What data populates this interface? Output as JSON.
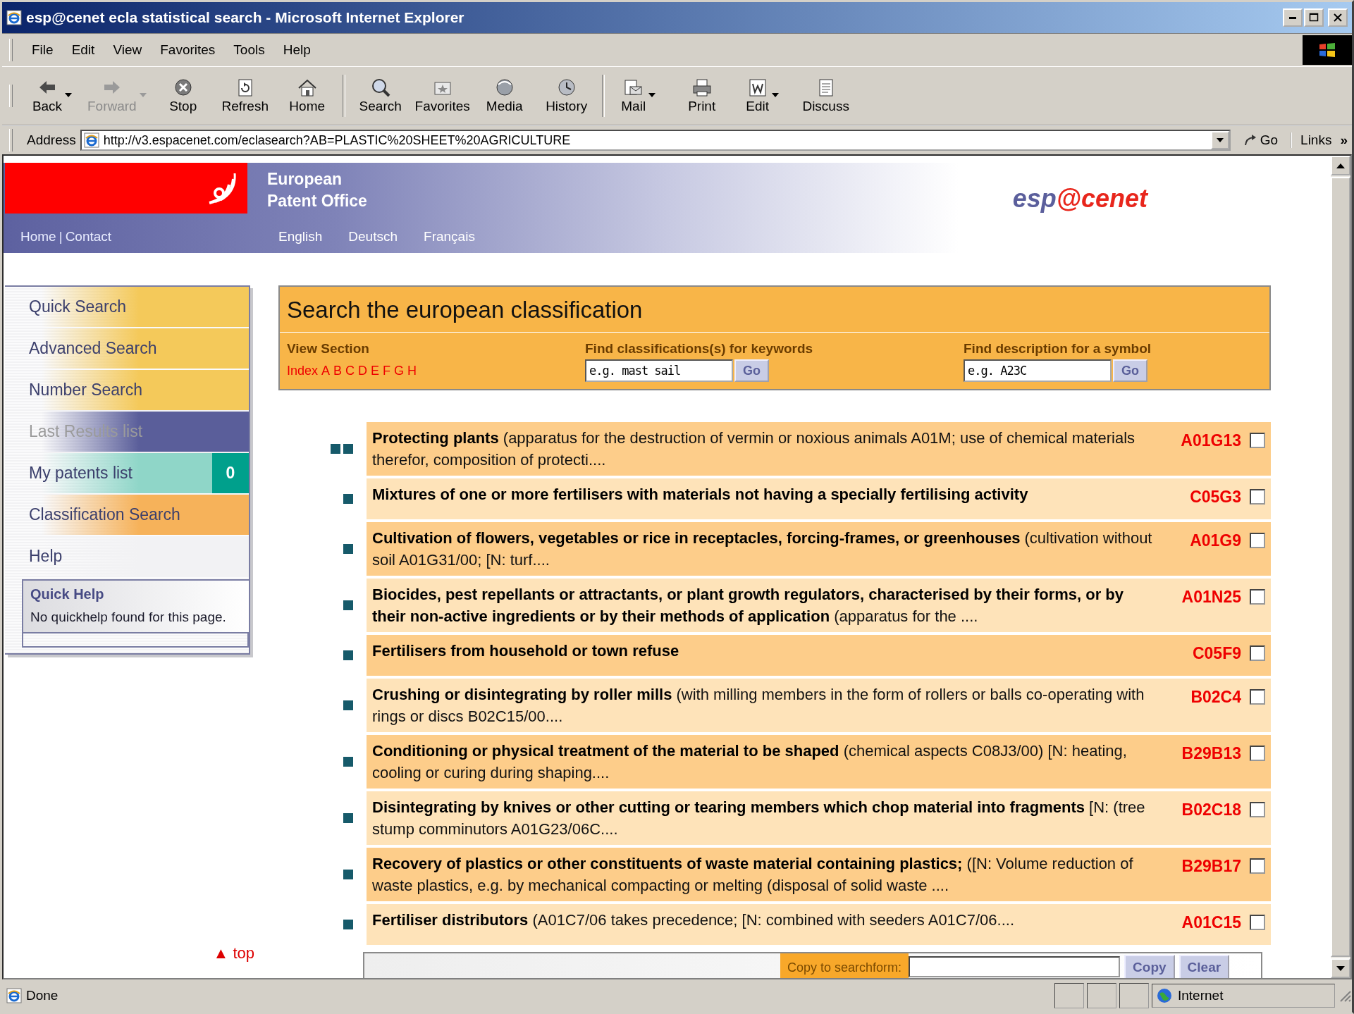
{
  "window": {
    "title": "esp@cenet ecla statistical search - Microsoft Internet Explorer"
  },
  "menu": [
    "File",
    "Edit",
    "View",
    "Favorites",
    "Tools",
    "Help"
  ],
  "toolbar": [
    [
      {
        "label": "Back",
        "kind": "back",
        "disabled": false,
        "dropdown": true
      },
      {
        "label": "Forward",
        "kind": "forward",
        "disabled": true,
        "dropdown": true
      },
      {
        "label": "Stop",
        "kind": "stop",
        "disabled": false,
        "dropdown": false
      },
      {
        "label": "Refresh",
        "kind": "refresh",
        "disabled": false,
        "dropdown": false
      },
      {
        "label": "Home",
        "kind": "home",
        "disabled": false,
        "dropdown": false
      }
    ],
    [
      {
        "label": "Search",
        "kind": "search",
        "disabled": false,
        "dropdown": false
      },
      {
        "label": "Favorites",
        "kind": "favorites",
        "disabled": false,
        "dropdown": false
      },
      {
        "label": "Media",
        "kind": "media",
        "disabled": false,
        "dropdown": false
      },
      {
        "label": "History",
        "kind": "history",
        "disabled": false,
        "dropdown": false
      }
    ],
    [
      {
        "label": "Mail",
        "kind": "mail",
        "disabled": false,
        "dropdown": true
      },
      {
        "label": "Print",
        "kind": "print",
        "disabled": false,
        "dropdown": false
      },
      {
        "label": "Edit",
        "kind": "edit",
        "disabled": false,
        "dropdown": true
      },
      {
        "label": "Discuss",
        "kind": "discuss",
        "disabled": false,
        "dropdown": false
      }
    ]
  ],
  "address": {
    "label": "Address",
    "url": "http://v3.espacenet.com/eclasearch?AB=PLASTIC%20SHEET%20AGRICULTURE",
    "go": "Go",
    "links": "Links",
    "more": "»"
  },
  "site_header": {
    "org": [
      "European",
      "Patent Office"
    ],
    "home_links": [
      "Home",
      "|",
      "Contact"
    ],
    "languages": [
      "English",
      "Deutsch",
      "Français"
    ],
    "logo": [
      {
        "text": "esp",
        "color": "#5b5f9c"
      },
      {
        "text": "@",
        "color": "#e8261c"
      },
      {
        "text": "cenet",
        "color": "#e8261c"
      }
    ]
  },
  "sidebar": {
    "items": [
      {
        "label": "Quick Search",
        "color": "#f4c95a",
        "disabled": false
      },
      {
        "label": "Advanced Search",
        "color": "#f4c95a",
        "disabled": false
      },
      {
        "label": "Number Search",
        "color": "#f4c95a",
        "disabled": false
      },
      {
        "label": "Last Results list",
        "color": "#5a5e9a",
        "disabled": true
      },
      {
        "label": "My patents list",
        "color": "#8fd6c8",
        "disabled": false,
        "badge": "0"
      },
      {
        "label": "Classification Search",
        "color": "#f6b25a",
        "disabled": false
      },
      {
        "label": "Help",
        "color": "#f2f2f4",
        "disabled": false
      }
    ],
    "quick_help": {
      "title": "Quick Help",
      "text": "No quickhelp found for this page."
    },
    "top_link": {
      "arrow": "▲",
      "label": "top"
    }
  },
  "search_panel": {
    "title": "Search the european classification",
    "view_section": {
      "label": "View Section",
      "index": "Index",
      "letters": [
        "A",
        "B",
        "C",
        "D",
        "E",
        "F",
        "G",
        "H"
      ]
    },
    "keywords": {
      "label": "Find classifications(s) for keywords",
      "value": "e.g. mast sail",
      "button": "Go"
    },
    "symbol": {
      "label": "Find description for a symbol",
      "value": "e.g. A23C",
      "button": "Go"
    }
  },
  "results": [
    {
      "kind": "double",
      "text": "**Protecting plants** (apparatus for the destruction of vermin or noxious animals A01M; use of chemical materials therefor, composition of protecti....",
      "code": "A01G13",
      "checked": false
    },
    {
      "kind": "single",
      "text": "**Mixtures of one or more fertilisers with materials not having a specially fertilising activity**",
      "code": "C05G3",
      "checked": false
    },
    {
      "kind": "single",
      "text": "**Cultivation of flowers, vegetables or rice in receptacles, forcing-frames, or greenhouses** (cultivation without soil A01G31/00; [N: turf....",
      "code": "A01G9",
      "checked": false
    },
    {
      "kind": "single",
      "text": "**Biocides, pest repellants or attractants, or plant growth regulators, characterised by their forms, or by their non-active ingredients or by their methods of application** (apparatus for the ....",
      "code": "A01N25",
      "checked": false
    },
    {
      "kind": "single",
      "text": "**Fertilisers from household or town refuse**",
      "code": "C05F9",
      "checked": false
    },
    {
      "kind": "single",
      "text": "**Crushing or disintegrating by roller mills** (with milling members in the form of rollers or balls co-operating with rings or discs B02C15/00....",
      "code": "B02C4",
      "checked": false
    },
    {
      "kind": "single",
      "text": "**Conditioning or physical treatment of the material to be shaped** (chemical aspects C08J3/00) [N: heating, cooling or curing during shaping....",
      "code": "B29B13",
      "checked": false
    },
    {
      "kind": "single",
      "text": "**Disintegrating by knives or other cutting or tearing members which chop material into fragments** [N: (tree stump comminutors A01G23/06C....",
      "code": "B02C18",
      "checked": false
    },
    {
      "kind": "single",
      "text": "**Recovery of plastics or other constituents of waste material containing plastics;** ([N: Volume reduction of waste plastics, e.g. by mechanical compacting or melting (disposal of solid waste ....",
      "code": "B29B17",
      "checked": false
    },
    {
      "kind": "single",
      "text": "**Fertiliser distributors** (A01C7/06 takes precedence; [N: combined with seeders A01C7/06....",
      "code": "A01C15",
      "checked": false
    }
  ],
  "copy_bar": {
    "label": "Copy to searchform:",
    "buttons": [
      "Copy",
      "Clear"
    ]
  },
  "status_bar": {
    "text": "Done",
    "zone": "Internet"
  }
}
